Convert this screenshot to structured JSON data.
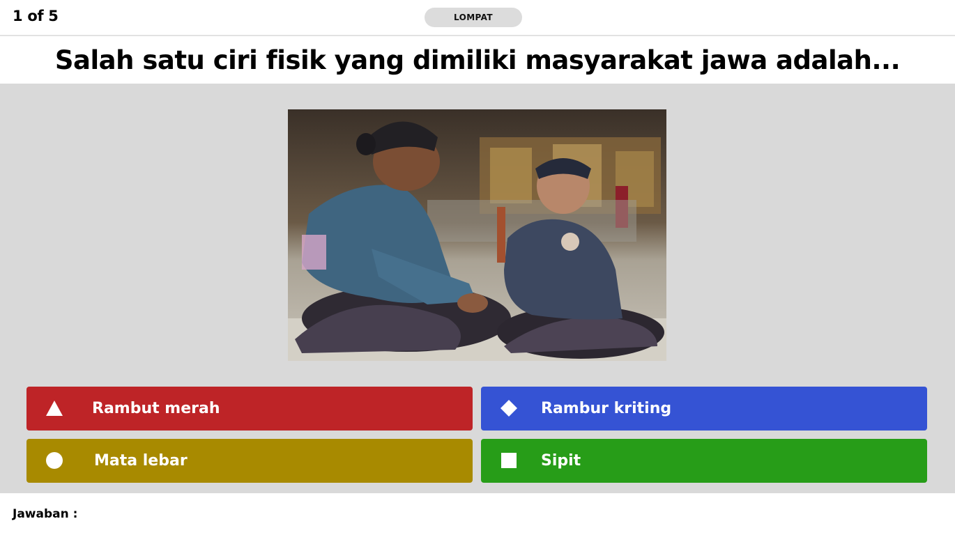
{
  "header": {
    "counter": "1 of 5",
    "skip_label": "LOMPAT"
  },
  "question": {
    "text": "Salah satu ciri fisik yang dimiliki  masyarakat jawa adalah..."
  },
  "answers": [
    {
      "label": "Rambut merah",
      "icon": "triangle-icon",
      "color": "#be2427"
    },
    {
      "label": "Rambur kriting",
      "icon": "diamond-icon",
      "color": "#3553d4"
    },
    {
      "label": "Mata lebar",
      "icon": "circle-icon",
      "color": "#a88a00"
    },
    {
      "label": "Sipit",
      "icon": "square-icon",
      "color": "#279d18"
    }
  ],
  "footer": {
    "answer_label": "Jawaban :"
  }
}
